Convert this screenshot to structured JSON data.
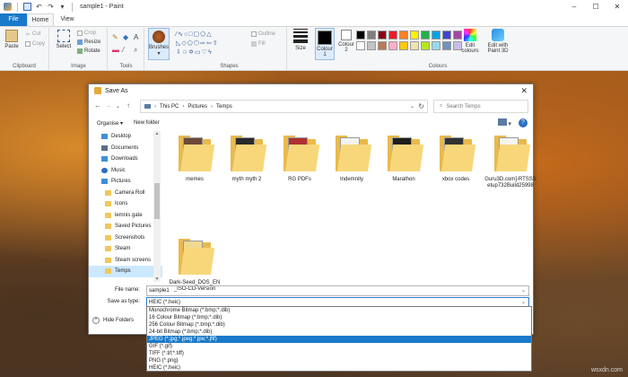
{
  "titlebar": {
    "title": "sample1 - Paint"
  },
  "window_controls": {
    "minimize": "–",
    "maximize": "☐",
    "close": "✕"
  },
  "tabs": {
    "file": "File",
    "home": "Home",
    "view": "View"
  },
  "ribbon": {
    "clipboard": {
      "label": "Clipboard",
      "paste": "Paste",
      "cut": "Cut",
      "copy": "Copy"
    },
    "image": {
      "label": "Image",
      "select": "Select",
      "crop": "Crop",
      "resize": "Resize",
      "rotate": "Rotate"
    },
    "tools": {
      "label": "Tools"
    },
    "brushes": "Brushes",
    "shapes": {
      "label": "Shapes",
      "outline": "Outline",
      "fill": "Fill"
    },
    "size": "Size",
    "colour1": "Colour 1",
    "colour2": "Colour 2",
    "colours": {
      "label": "Colours",
      "edit_colours": "Edit colours",
      "edit_paint3d": "Edit with Paint 3D"
    },
    "palette": [
      "#000000",
      "#7f7f7f",
      "#880015",
      "#ed1c24",
      "#ff7f27",
      "#fff200",
      "#22b14c",
      "#00a2e8",
      "#3f48cc",
      "#a349a4",
      "#ffffff",
      "#c3c3c3",
      "#b97a57",
      "#ffaec9",
      "#ffc90e",
      "#efe4b0",
      "#b5e61d",
      "#99d9ea",
      "#7092be",
      "#c8bfe7"
    ]
  },
  "dialog": {
    "title": "Save As",
    "breadcrumb": [
      "This PC",
      "Pictures",
      "Temps"
    ],
    "search_placeholder": "Search Temps",
    "organise": "Organise ▾",
    "new_folder": "New folder",
    "nav_items": [
      {
        "label": "Desktop",
        "icon": "desktop-icon"
      },
      {
        "label": "Documents",
        "icon": "documents-icon"
      },
      {
        "label": "Downloads",
        "icon": "downloads-icon"
      },
      {
        "label": "Music",
        "icon": "music-icon"
      },
      {
        "label": "Pictures",
        "icon": "pictures-icon"
      },
      {
        "label": "Camera Roll",
        "icon": "folder-icon"
      },
      {
        "label": "Icons",
        "icon": "folder-icon"
      },
      {
        "label": "lemnis gate",
        "icon": "folder-icon"
      },
      {
        "label": "Saved Pictures",
        "icon": "folder-icon"
      },
      {
        "label": "Screenshots",
        "icon": "folder-icon"
      },
      {
        "label": "Steam",
        "icon": "folder-icon"
      },
      {
        "label": "Steam screens",
        "icon": "folder-icon"
      },
      {
        "label": "Temps",
        "icon": "folder-icon"
      }
    ],
    "folders": [
      {
        "name": "memes",
        "paper": "#6b4a3a"
      },
      {
        "name": "myth myth 2",
        "paper": "#2a2a2a"
      },
      {
        "name": "RG PDFs",
        "paper": "#b03030"
      },
      {
        "name": "Indemnity",
        "paper": "#f3f3f3"
      },
      {
        "name": "Marathon",
        "paper": "#1f1f1f"
      },
      {
        "name": "xbox codes",
        "paper": "#333333"
      },
      {
        "name": "Guru3D.com]-RTSSSetup732Build25998",
        "paper": "#f5f5f5"
      },
      {
        "name": "Dark-Seed_DOS_EN_ISO-CD-Version",
        "paper": "#f0d890"
      }
    ],
    "file_name_label": "File name:",
    "file_name_value": "sample1",
    "save_as_type_label": "Save as type:",
    "save_as_type_value": "HEIC (*.heic)",
    "hide_folders": "Hide Folders",
    "type_options": [
      "Monochrome Bitmap (*.bmp;*.dib)",
      "16 Colour Bitmap (*.bmp;*.dib)",
      "256 Colour Bitmap (*.bmp;*.dib)",
      "24-bit Bitmap (*.bmp;*.dib)",
      "JPEG (*.jpg;*.jpeg;*.jpe;*.jfif)",
      "GIF (*.gif)",
      "TIFF (*.tif;*.tiff)",
      "PNG (*.png)",
      "HEIC (*.heic)"
    ],
    "highlighted_option": 4
  },
  "watermark": "wsxdn.com"
}
